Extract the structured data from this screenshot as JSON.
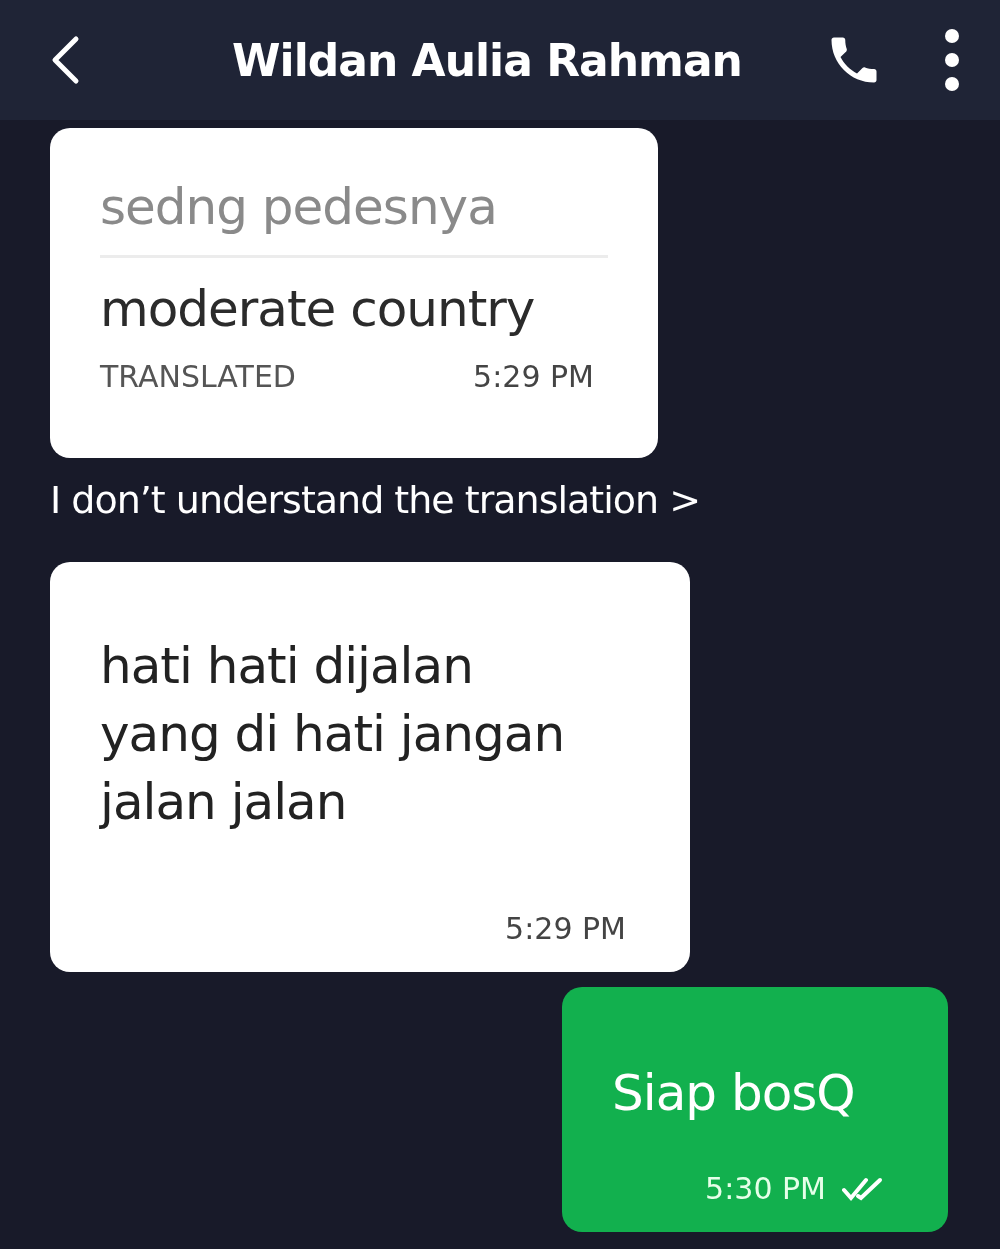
{
  "header": {
    "title": "Wildan Aulia Rahman"
  },
  "messages": [
    {
      "kind": "translated",
      "original": "sedng pedesnya",
      "translation": "moderate country",
      "tag": "TRANSLATED",
      "time": "5:29 PM",
      "note": "I don’t understand the translation >"
    },
    {
      "kind": "incoming",
      "text": "hati hati dijalan\nyang di hati jangan\njalan jalan",
      "time": "5:29 PM"
    },
    {
      "kind": "outgoing",
      "text": "Siap bosQ",
      "time": "5:30 PM",
      "read": true
    }
  ]
}
